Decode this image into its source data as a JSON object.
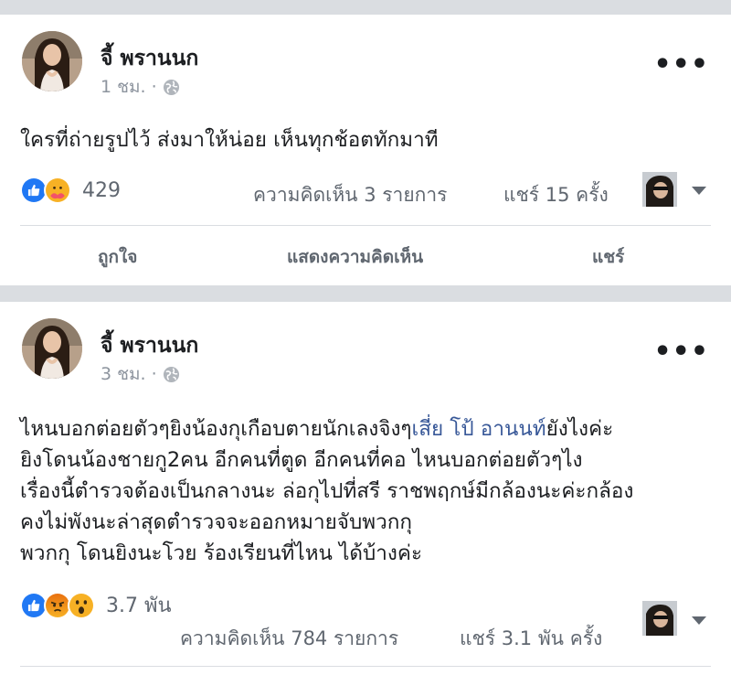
{
  "posts": [
    {
      "author": "จี้ พรานนก",
      "time": "1 ชม. ·",
      "text_lines": [
        "ใครที่ถ่ายรูปไว้ ส่งมาให้น่อย เห็นทุกช้อตทักมาที"
      ],
      "reactions": [
        "like-icon",
        "care-icon"
      ],
      "reaction_count": "429",
      "comments": "ความคิดเห็น 3 รายการ",
      "shares": "แชร์ 15 ครั้ง",
      "actions": {
        "like": "ถูกใจ",
        "comment": "แสดงความคิดเห็น",
        "share": "แชร์"
      }
    },
    {
      "author": "จี้ พรานนก",
      "time": "3 ชม. ·",
      "text_line1_pre": "ไหนบอกต่อยตัวๆยิงน้องกุเกือบตายนักเลงจิงๆ",
      "text_line1_link": "เสี่ย โป้ อานนท์",
      "text_line1_post": "ยังไงค่ะ",
      "text_lines": [
        "ยิงโดนน้องชายกู2คน อีกคนที่ตูด อีกคนที่คอ ไหนบอกต่อยตัวๆไง",
        "เรื่องนี้ตำรวจต้องเป็นกลางนะ ล่อกุไปที่สรี ราชพฤกษ์มีกล้องนะค่ะกล้อง",
        "คงไม่พังนะล่าสุดตำรวจจะออกหมายจับพวกกุ",
        "พวกกุ โดนยิงนะโวย ร้องเรียนที่ไหน ได้บ้างค่ะ"
      ],
      "reactions": [
        "like-icon",
        "angry-icon",
        "wow-icon"
      ],
      "reaction_count": "3.7 พัน",
      "comments": "ความคิดเห็น 784 รายการ",
      "shares": "แชร์ 3.1 พัน ครั้ง"
    }
  ],
  "colors": {
    "link": "#385898",
    "like_blue": "#2078f4",
    "angry": "#e9710f",
    "wow": "#f7b125"
  }
}
